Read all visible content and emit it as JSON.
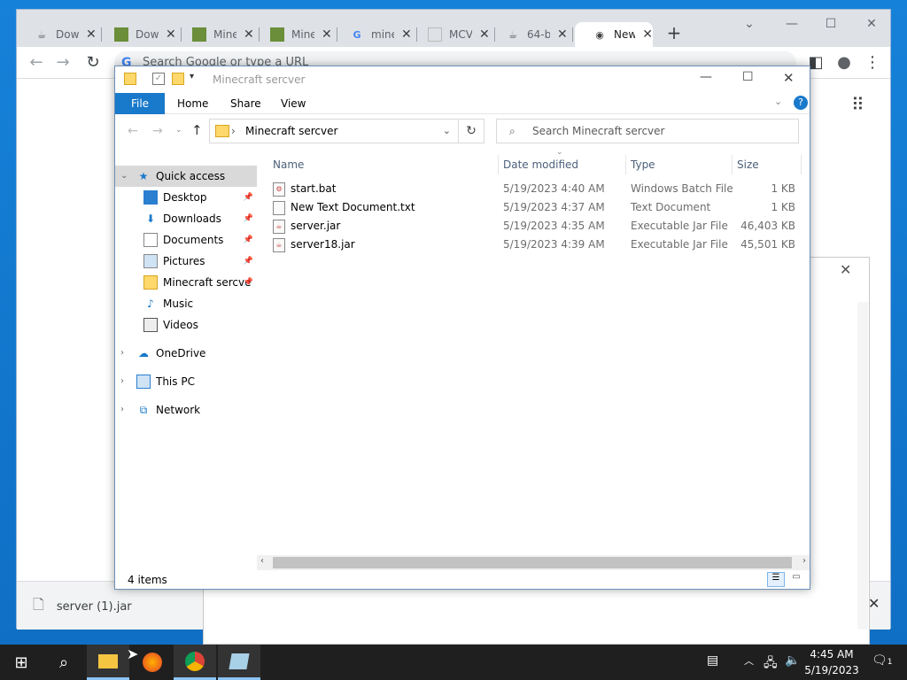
{
  "chrome": {
    "tabs": [
      {
        "label": "Dow",
        "icon": "java-icon"
      },
      {
        "label": "Dow",
        "icon": "minecraft-icon"
      },
      {
        "label": "Mine",
        "icon": "minecraft-icon"
      },
      {
        "label": "Mine",
        "icon": "minecraft-icon"
      },
      {
        "label": "mine",
        "icon": "google-icon"
      },
      {
        "label": "MCV",
        "icon": "page-icon"
      },
      {
        "label": "64-b",
        "icon": "java-icon"
      },
      {
        "label": "New",
        "icon": "chrome-icon"
      }
    ],
    "omnibox_placeholder": "Search Google or type a URL",
    "download": {
      "filename": "server (1).jar"
    }
  },
  "explorer": {
    "title": "Minecraft sercver",
    "ribbon": {
      "file": "File",
      "home": "Home",
      "share": "Share",
      "view": "View"
    },
    "address": "Minecraft sercver",
    "search_placeholder": "Search Minecraft sercver",
    "nav": {
      "quick_access": "Quick access",
      "desktop": "Desktop",
      "downloads": "Downloads",
      "documents": "Documents",
      "pictures": "Pictures",
      "minecraft": "Minecraft sercve",
      "music": "Music",
      "videos": "Videos",
      "onedrive": "OneDrive",
      "thispc": "This PC",
      "network": "Network"
    },
    "columns": {
      "name": "Name",
      "date": "Date modified",
      "type": "Type",
      "size": "Size"
    },
    "files": [
      {
        "name": "start.bat",
        "date": "5/19/2023 4:40 AM",
        "type": "Windows Batch File",
        "size": "1 KB"
      },
      {
        "name": "New Text Document.txt",
        "date": "5/19/2023 4:37 AM",
        "type": "Text Document",
        "size": "1 KB"
      },
      {
        "name": "server.jar",
        "date": "5/19/2023 4:35 AM",
        "type": "Executable Jar File",
        "size": "46,403 KB"
      },
      {
        "name": "server18.jar",
        "date": "5/19/2023 4:39 AM",
        "type": "Executable Jar File",
        "size": "45,501 KB"
      }
    ],
    "status": "4 items"
  },
  "taskbar": {
    "time": "4:45 AM",
    "date": "5/19/2023",
    "notifications": "1"
  }
}
